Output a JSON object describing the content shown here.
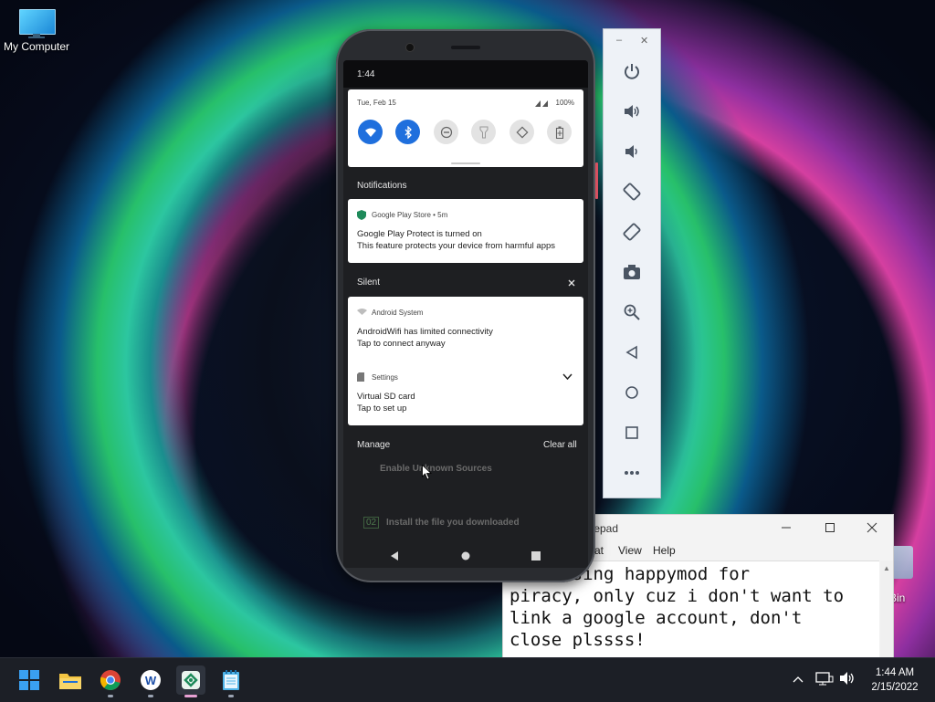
{
  "desktop": {
    "my_computer_label": "My Computer",
    "recycle_bin_label": "e Bin"
  },
  "notepad": {
    "title": "tepad",
    "menu": [
      "at",
      "View",
      "Help"
    ],
    "content": "   t using happymod for\npiracy, only cuz i don't want to\nlink a google account, don't\nclose plssss!"
  },
  "phone": {
    "status_time": "1:44",
    "qs": {
      "date": "Tue, Feb 15",
      "battery": "100%",
      "tiles": [
        {
          "icon": "wifi-icon",
          "state": "on"
        },
        {
          "icon": "bluetooth-icon",
          "state": "on"
        },
        {
          "icon": "do-not-disturb-icon",
          "state": "off"
        },
        {
          "icon": "flashlight-icon",
          "state": "off"
        },
        {
          "icon": "auto-rotate-icon",
          "state": "off"
        },
        {
          "icon": "battery-saver-icon",
          "state": "off"
        }
      ]
    },
    "notifications_label": "Notifications",
    "play_card": {
      "app": "Google Play Store • 5m",
      "title": "Google Play Protect is turned on",
      "body": "This feature protects your device from harmful apps"
    },
    "silent_label": "Silent",
    "system_card": {
      "app1": "Android System",
      "title1": "AndroidWifi has limited connectivity",
      "body1": "Tap to connect anyway",
      "app2": "Settings",
      "title2": "Virtual SD card",
      "body2": "Tap to set up"
    },
    "manage_label": "Manage",
    "clear_all_label": "Clear all",
    "behind": {
      "step1": "Enable Unknown Sources",
      "step2_num": "02",
      "step2": "Install the file you downloaded"
    }
  },
  "emulator_toolbar": {
    "minimize": "–",
    "close": "✕",
    "buttons": [
      "power-icon",
      "volume-up-icon",
      "volume-down-icon",
      "rotate-left-icon",
      "rotate-right-icon",
      "camera-icon",
      "zoom-icon",
      "back-icon",
      "home-icon",
      "overview-icon",
      "more-icon"
    ]
  },
  "taskbar": {
    "apps": [
      "start-icon",
      "file-explorer-icon",
      "chrome-icon",
      "word-app-icon",
      "android-studio-icon",
      "notepad-icon"
    ],
    "time": "1:44 AM",
    "date": "2/15/2022"
  },
  "colors": {
    "accent_blue": "#1f6fdd",
    "taskbar": "#1c1f26",
    "emulator_toolbar": "#eef2f7"
  }
}
